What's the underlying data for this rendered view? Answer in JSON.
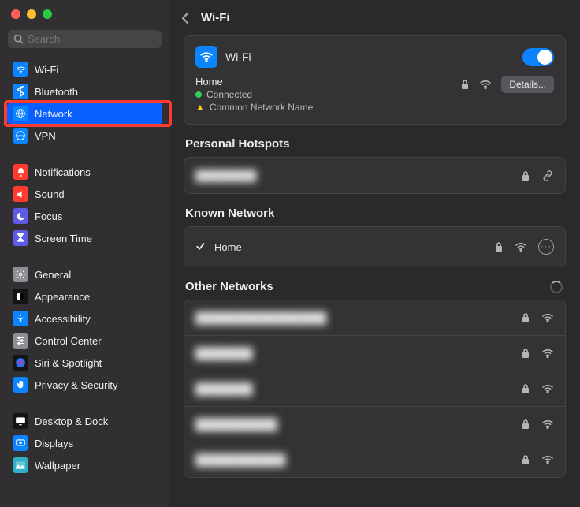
{
  "sidebar": {
    "search_placeholder": "Search",
    "groups": [
      [
        {
          "label": "Wi-Fi",
          "icon": "wifi-icon",
          "bg": "#0b84ff"
        },
        {
          "label": "Bluetooth",
          "icon": "bluetooth-icon",
          "bg": "#0b84ff"
        },
        {
          "label": "Network",
          "icon": "globe-icon",
          "bg": "#0b84ff",
          "active": true,
          "highlight": true
        },
        {
          "label": "VPN",
          "icon": "vpn-icon",
          "bg": "#0b84ff"
        }
      ],
      [
        {
          "label": "Notifications",
          "icon": "bell-icon",
          "bg": "#ff3b30"
        },
        {
          "label": "Sound",
          "icon": "sound-icon",
          "bg": "#ff3b30"
        },
        {
          "label": "Focus",
          "icon": "moon-icon",
          "bg": "#5e5ce6"
        },
        {
          "label": "Screen Time",
          "icon": "hourglass-icon",
          "bg": "#5e5ce6"
        }
      ],
      [
        {
          "label": "General",
          "icon": "gear-icon",
          "bg": "#8e8e93"
        },
        {
          "label": "Appearance",
          "icon": "appearance-icon",
          "bg": "#141414"
        },
        {
          "label": "Accessibility",
          "icon": "accessibility-icon",
          "bg": "#0b84ff"
        },
        {
          "label": "Control Center",
          "icon": "control-center-icon",
          "bg": "#8e8e93"
        },
        {
          "label": "Siri & Spotlight",
          "icon": "siri-icon",
          "bg": "#141414"
        },
        {
          "label": "Privacy & Security",
          "icon": "hand-icon",
          "bg": "#0b84ff"
        }
      ],
      [
        {
          "label": "Desktop & Dock",
          "icon": "desktop-icon",
          "bg": "#141414"
        },
        {
          "label": "Displays",
          "icon": "displays-icon",
          "bg": "#0b84ff"
        },
        {
          "label": "Wallpaper",
          "icon": "wallpaper-icon",
          "bg": "#30b0c7"
        }
      ]
    ]
  },
  "header": {
    "title": "Wi-Fi"
  },
  "wifi": {
    "label": "Wi-Fi",
    "network_name": "Home",
    "status": "Connected",
    "warning": "Common Network Name",
    "details_label": "Details...",
    "enabled": true
  },
  "personal_hotspots": {
    "title": "Personal Hotspots",
    "items": [
      {
        "name": "████████",
        "locked": true,
        "link": true
      }
    ]
  },
  "known_network": {
    "title": "Known Network",
    "items": [
      {
        "name": "Home",
        "checked": true,
        "locked": true,
        "wifi": true,
        "more": true
      }
    ]
  },
  "other_networks": {
    "title": "Other Networks",
    "loading": true,
    "items": [
      {
        "name": "████████████████",
        "locked": true,
        "wifi": true
      },
      {
        "name": "███████",
        "locked": true,
        "wifi": true
      },
      {
        "name": "███████",
        "locked": true,
        "wifi": true
      },
      {
        "name": "██████████",
        "locked": true,
        "wifi": true
      },
      {
        "name": "███████████",
        "locked": true,
        "wifi": true
      }
    ]
  }
}
